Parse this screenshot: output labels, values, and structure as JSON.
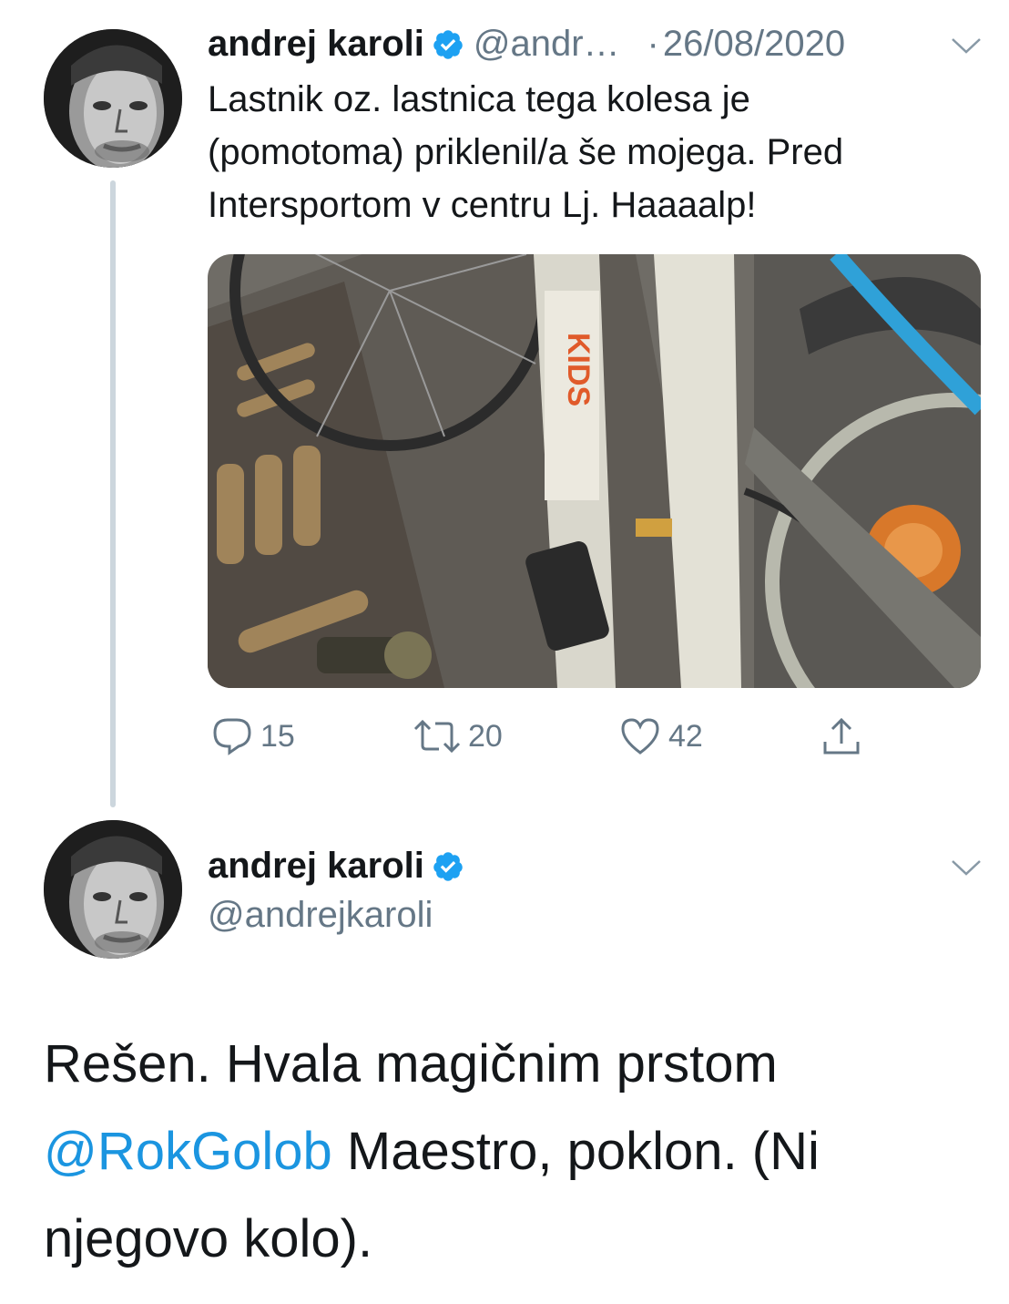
{
  "tweet1": {
    "author_name": "andrej karoli",
    "handle": "@andr…",
    "date_separator": "·",
    "date": "26/08/2020",
    "text": "Lastnik oz. lastnica tega kolesa je (pomotoma) priklenil/a še mojega. Pred Intersportom v centru Lj. Haaaalp!",
    "counts": {
      "replies": "15",
      "retweets": "20",
      "likes": "42"
    }
  },
  "tweet2": {
    "author_name": "andrej karoli",
    "handle": "@andrejkaroli",
    "text_before": "Rešen. Hvala magičnim prstom ",
    "mention": "@RokGolob",
    "text_after": " Maestro, poklon. (Ni njegovo kolo)."
  },
  "colors": {
    "accent": "#1b95e0",
    "verified": "#1da1f2",
    "secondary_text": "#657786",
    "thread_line": "#ccd6dd"
  },
  "icons": {
    "reply": "speech-bubble",
    "retweet": "retweet-arrows",
    "like": "heart",
    "share": "share-upload-arrow",
    "menu": "chevron-down",
    "verified": "verified-badge"
  }
}
